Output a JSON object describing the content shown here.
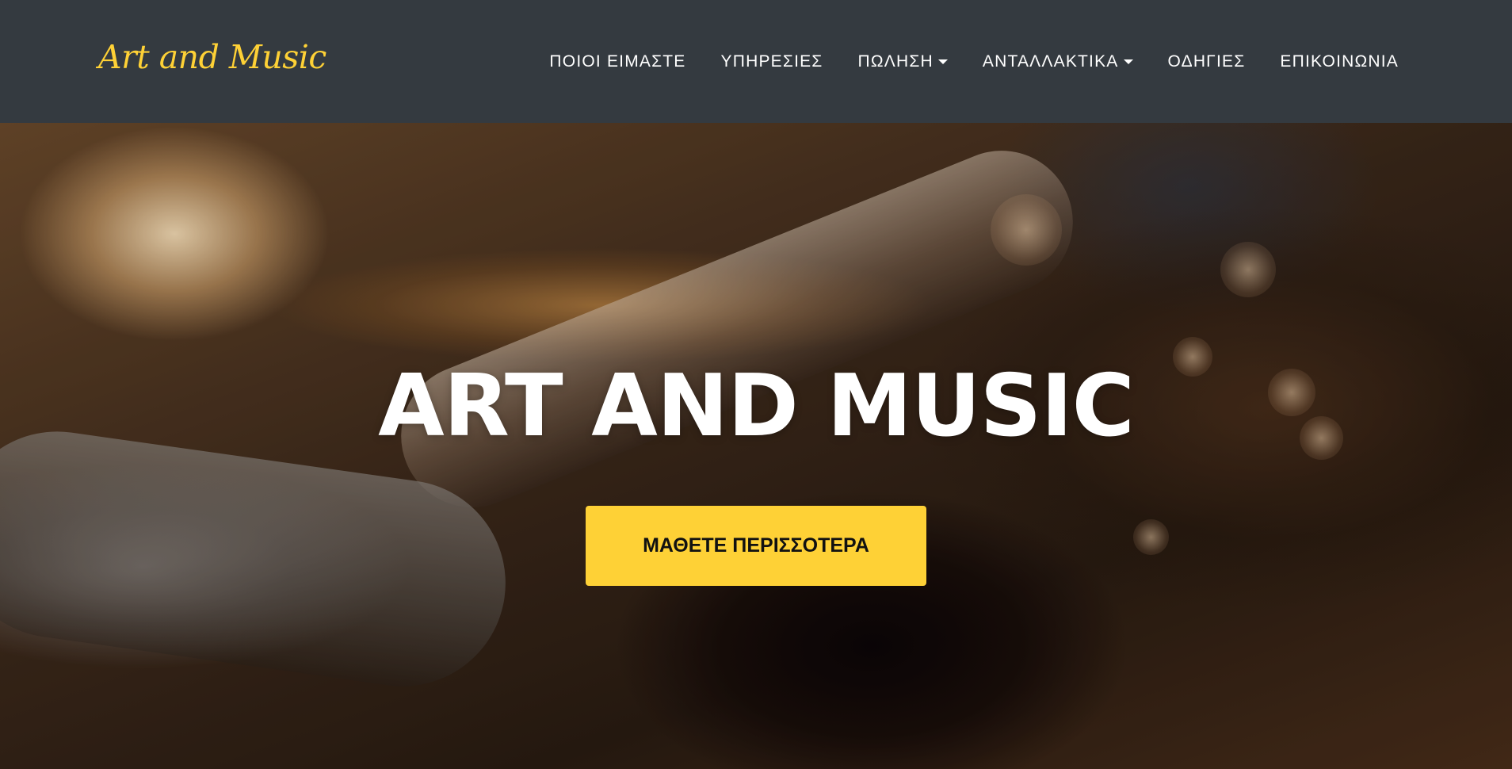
{
  "brand": {
    "name": "Art and Music",
    "color": "#fed136"
  },
  "nav": {
    "items": [
      {
        "label": "ΠΟΙΟΙ ΕΙΜΑΣΤΕ",
        "dropdown": false
      },
      {
        "label": "ΥΠΗΡΕΣΙΕΣ",
        "dropdown": false
      },
      {
        "label": "ΠΩΛΗΣΗ",
        "dropdown": true
      },
      {
        "label": "ΑΝΤΑΛΛΑΚΤΙΚΑ",
        "dropdown": true
      },
      {
        "label": "ΟΔΗΓΙΕΣ",
        "dropdown": false
      },
      {
        "label": "ΕΠΙΚΟΙΝΩΝΙΑ",
        "dropdown": false
      }
    ],
    "background": "#343a40"
  },
  "hero": {
    "title": "ART AND MUSIC",
    "cta_label": "ΜΑΘΕΤΕ ΠΕΡΙΣΣΟΤΕΡΑ",
    "cta_color": "#fed136",
    "image_subject": "saxophone close-up"
  }
}
